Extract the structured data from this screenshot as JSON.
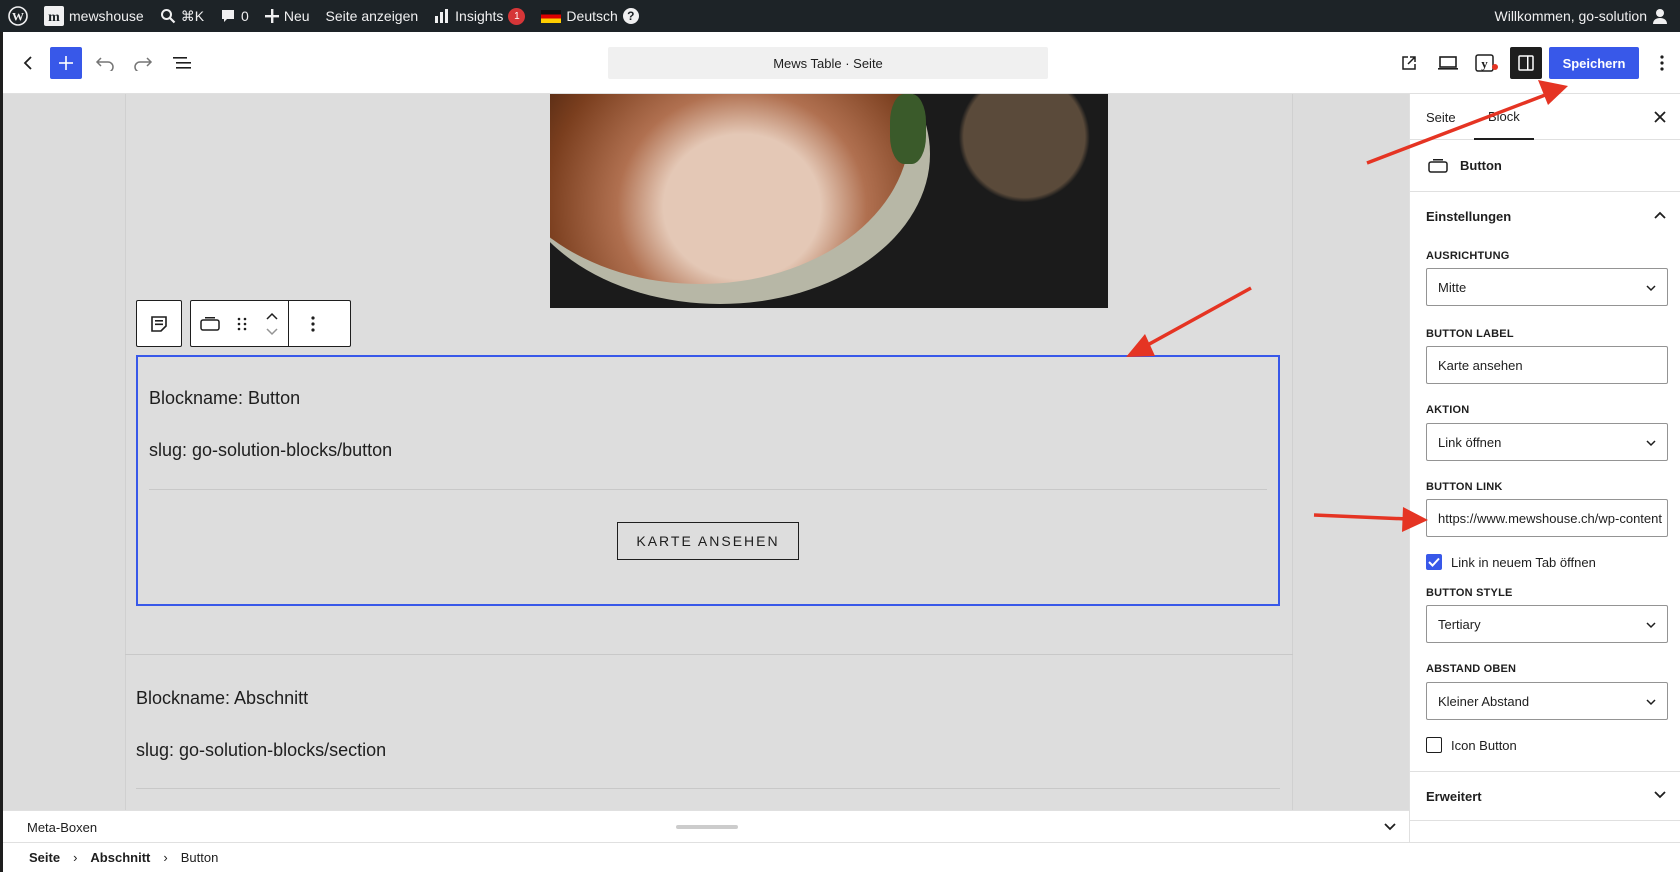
{
  "adminbar": {
    "site_name": "mewshouse",
    "search_shortcut": "⌘K",
    "comments_count": "0",
    "new_label": "Neu",
    "view_page": "Seite anzeigen",
    "insights_label": "Insights",
    "insights_badge": "1",
    "language": "Deutsch",
    "help": "?",
    "welcome": "Willkommen, go-solution"
  },
  "editor": {
    "document_title": "Mews Table · Seite",
    "save_label": "Speichern"
  },
  "canvas": {
    "button_block_name": "Blockname: Button",
    "button_block_slug": "slug: go-solution-blocks/button",
    "button_text": "KARTE ANSEHEN",
    "section_block_name": "Blockname: Abschnitt",
    "section_block_slug": "slug: go-solution-blocks/section",
    "metabox_label": "Meta-Boxen"
  },
  "breadcrumb": [
    "Seite",
    "Abschnitt",
    "Button"
  ],
  "sidebar": {
    "tabs": [
      "Seite",
      "Block"
    ],
    "active_tab": "Block",
    "block_name": "Button",
    "settings_title": "Einstellungen",
    "fields": {
      "alignment": {
        "label": "AUSRICHTUNG",
        "value": "Mitte"
      },
      "button_label": {
        "label": "BUTTON LABEL",
        "value": "Karte ansehen"
      },
      "action": {
        "label": "AKTION",
        "value": "Link öffnen"
      },
      "button_link": {
        "label": "BUTTON LINK",
        "value": "https://www.mewshouse.ch/wp-content"
      },
      "new_tab": {
        "label": "Link in neuem Tab öffnen",
        "checked": true
      },
      "button_style": {
        "label": "BUTTON STYLE",
        "value": "Tertiary"
      },
      "spacing_top": {
        "label": "ABSTAND OBEN",
        "value": "Kleiner Abstand"
      },
      "icon_button": {
        "label": "Icon Button",
        "checked": false
      }
    },
    "advanced_title": "Erweitert"
  },
  "colors": {
    "accent": "#3858e9",
    "admin_bar": "#1d2327",
    "annotation_arrow": "#e53423",
    "badge": "#d63638"
  }
}
